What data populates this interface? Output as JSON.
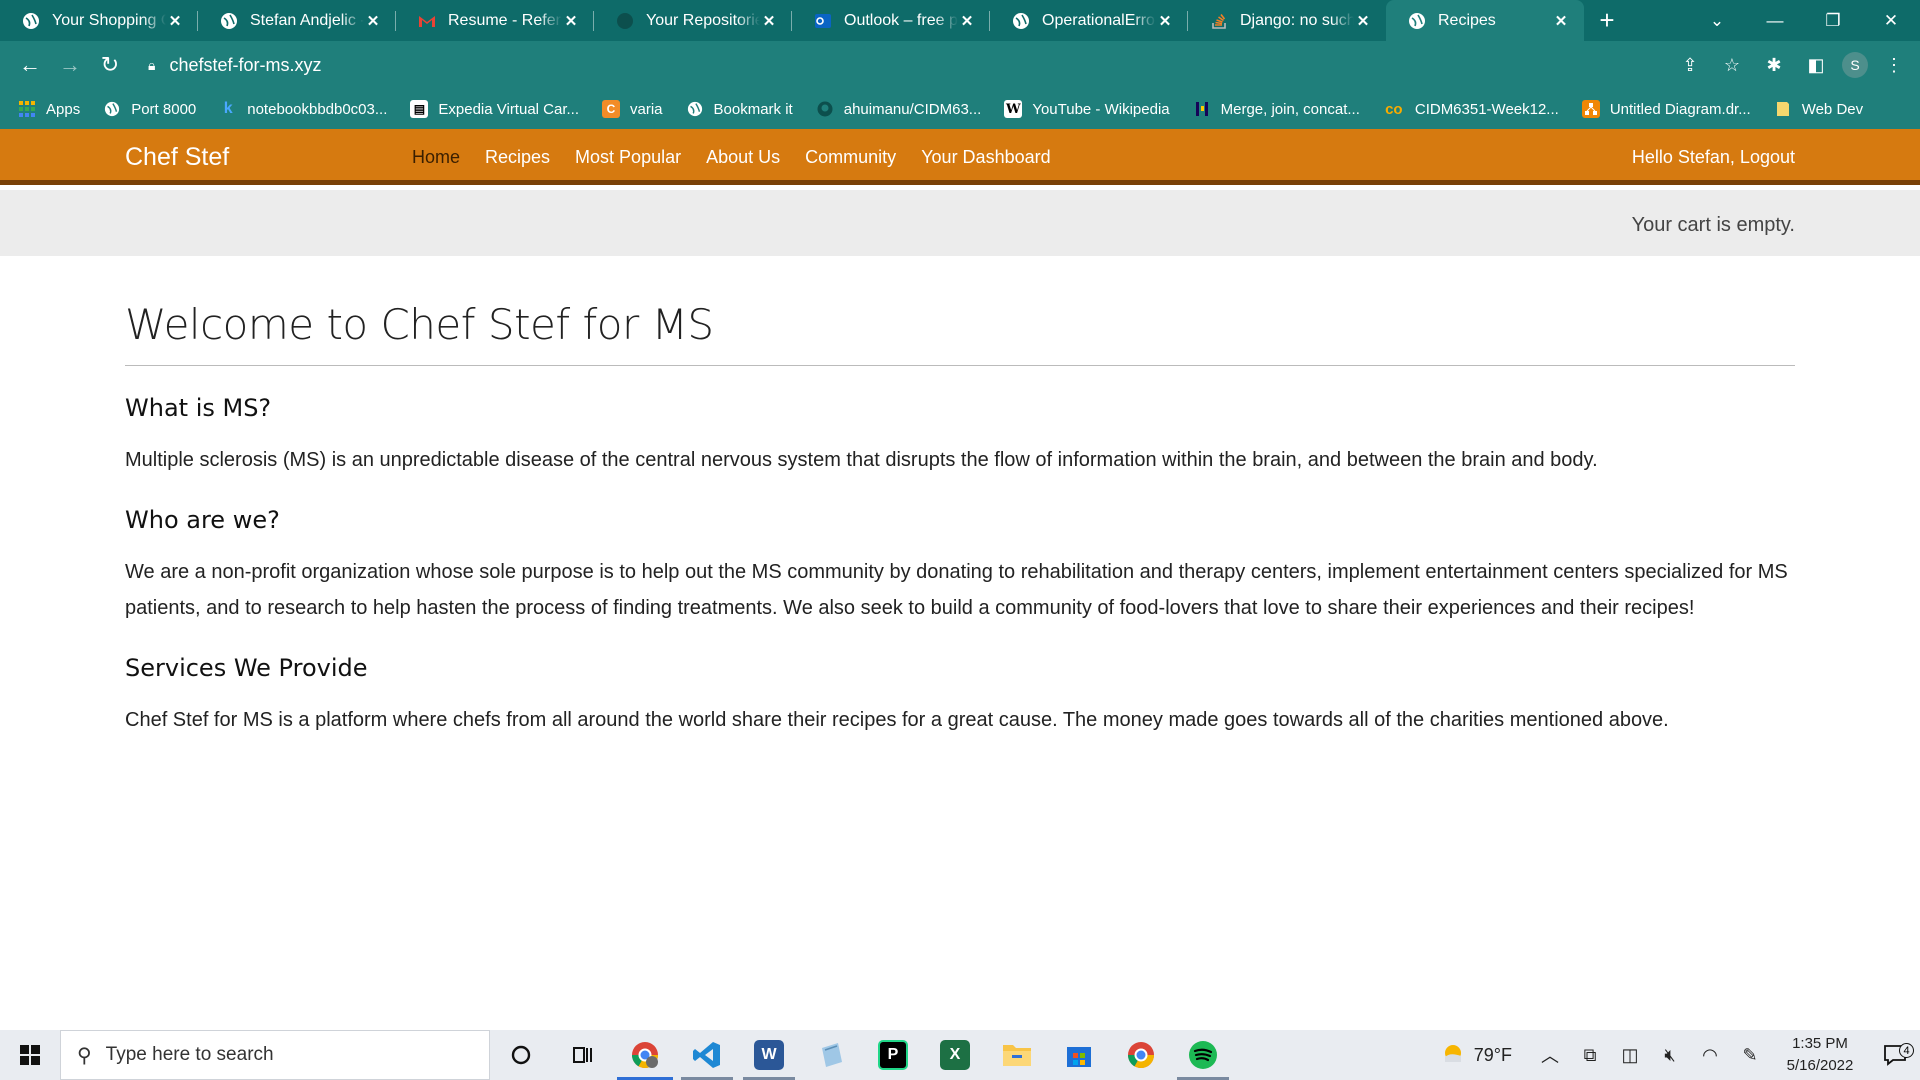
{
  "browser": {
    "tabs": [
      {
        "title": "Your Shopping Cart",
        "icon": "globe-icon"
      },
      {
        "title": "Stefan Andjelic - r",
        "icon": "globe-icon"
      },
      {
        "title": "Resume - Referre",
        "icon": "gmail-icon"
      },
      {
        "title": "Your Repositories",
        "icon": "github-icon"
      },
      {
        "title": "Outlook – free pe",
        "icon": "outlook-icon"
      },
      {
        "title": "OperationalError",
        "icon": "globe-icon"
      },
      {
        "title": "Django: no such t",
        "icon": "stackoverflow-icon"
      },
      {
        "title": "Recipes",
        "icon": "globe-icon",
        "active": true
      }
    ],
    "address": "chefstef-for-ms.xyz",
    "profile_initial": "S",
    "bookmarks": [
      {
        "label": "Apps",
        "icon": "apps-grid-icon"
      },
      {
        "label": "Port 8000",
        "icon": "globe-icon"
      },
      {
        "label": "notebookbbdb0c03...",
        "icon": "k-icon"
      },
      {
        "label": "Expedia Virtual Car...",
        "icon": "document-icon"
      },
      {
        "label": "varia",
        "icon": "c-icon"
      },
      {
        "label": "Bookmark it",
        "icon": "globe-icon"
      },
      {
        "label": "ahuimanu/CIDM63...",
        "icon": "github-icon"
      },
      {
        "label": "YouTube - Wikipedia",
        "icon": "wikipedia-icon"
      },
      {
        "label": "Merge, join, concat...",
        "icon": "pandas-icon"
      },
      {
        "label": "CIDM6351-Week12...",
        "icon": "colab-icon"
      },
      {
        "label": "Untitled Diagram.dr...",
        "icon": "drawio-icon"
      },
      {
        "label": "Web Dev",
        "icon": "folder-icon"
      }
    ]
  },
  "site": {
    "brand": "Chef Stef",
    "menu": [
      "Home",
      "Recipes",
      "Most Popular",
      "About Us",
      "Community",
      "Your Dashboard"
    ],
    "active_menu": "Home",
    "account": "Hello Stefan, Logout",
    "cart": "Your cart is empty."
  },
  "content": {
    "title": "Welcome to Chef Stef for MS",
    "sections": [
      {
        "heading": "What is MS?",
        "body": "Multiple sclerosis (MS) is an unpredictable disease of the central nervous system that disrupts the flow of information within the brain, and between the brain and body."
      },
      {
        "heading": "Who are we?",
        "body": "We are a non-profit organization whose sole purpose is to help out the MS community by donating to rehabilitation and therapy centers, implement entertainment centers specialized for MS patients, and to research to help hasten the process of finding treatments. We also seek to build a community of food-lovers that love to share their experiences and their recipes!"
      },
      {
        "heading": "Services We Provide",
        "body": "Chef Stef for MS is a platform where chefs from all around the world share their recipes for a great cause. The money made goes towards all of the charities mentioned above."
      }
    ]
  },
  "taskbar": {
    "search_placeholder": "Type here to search",
    "weather": "79°F",
    "time": "1:35 PM",
    "date": "5/16/2022",
    "notifications": "4"
  },
  "colors": {
    "browser_frame": "#1f7f7b",
    "navbar": "#d67a10",
    "navbar_border": "#7a4107"
  }
}
